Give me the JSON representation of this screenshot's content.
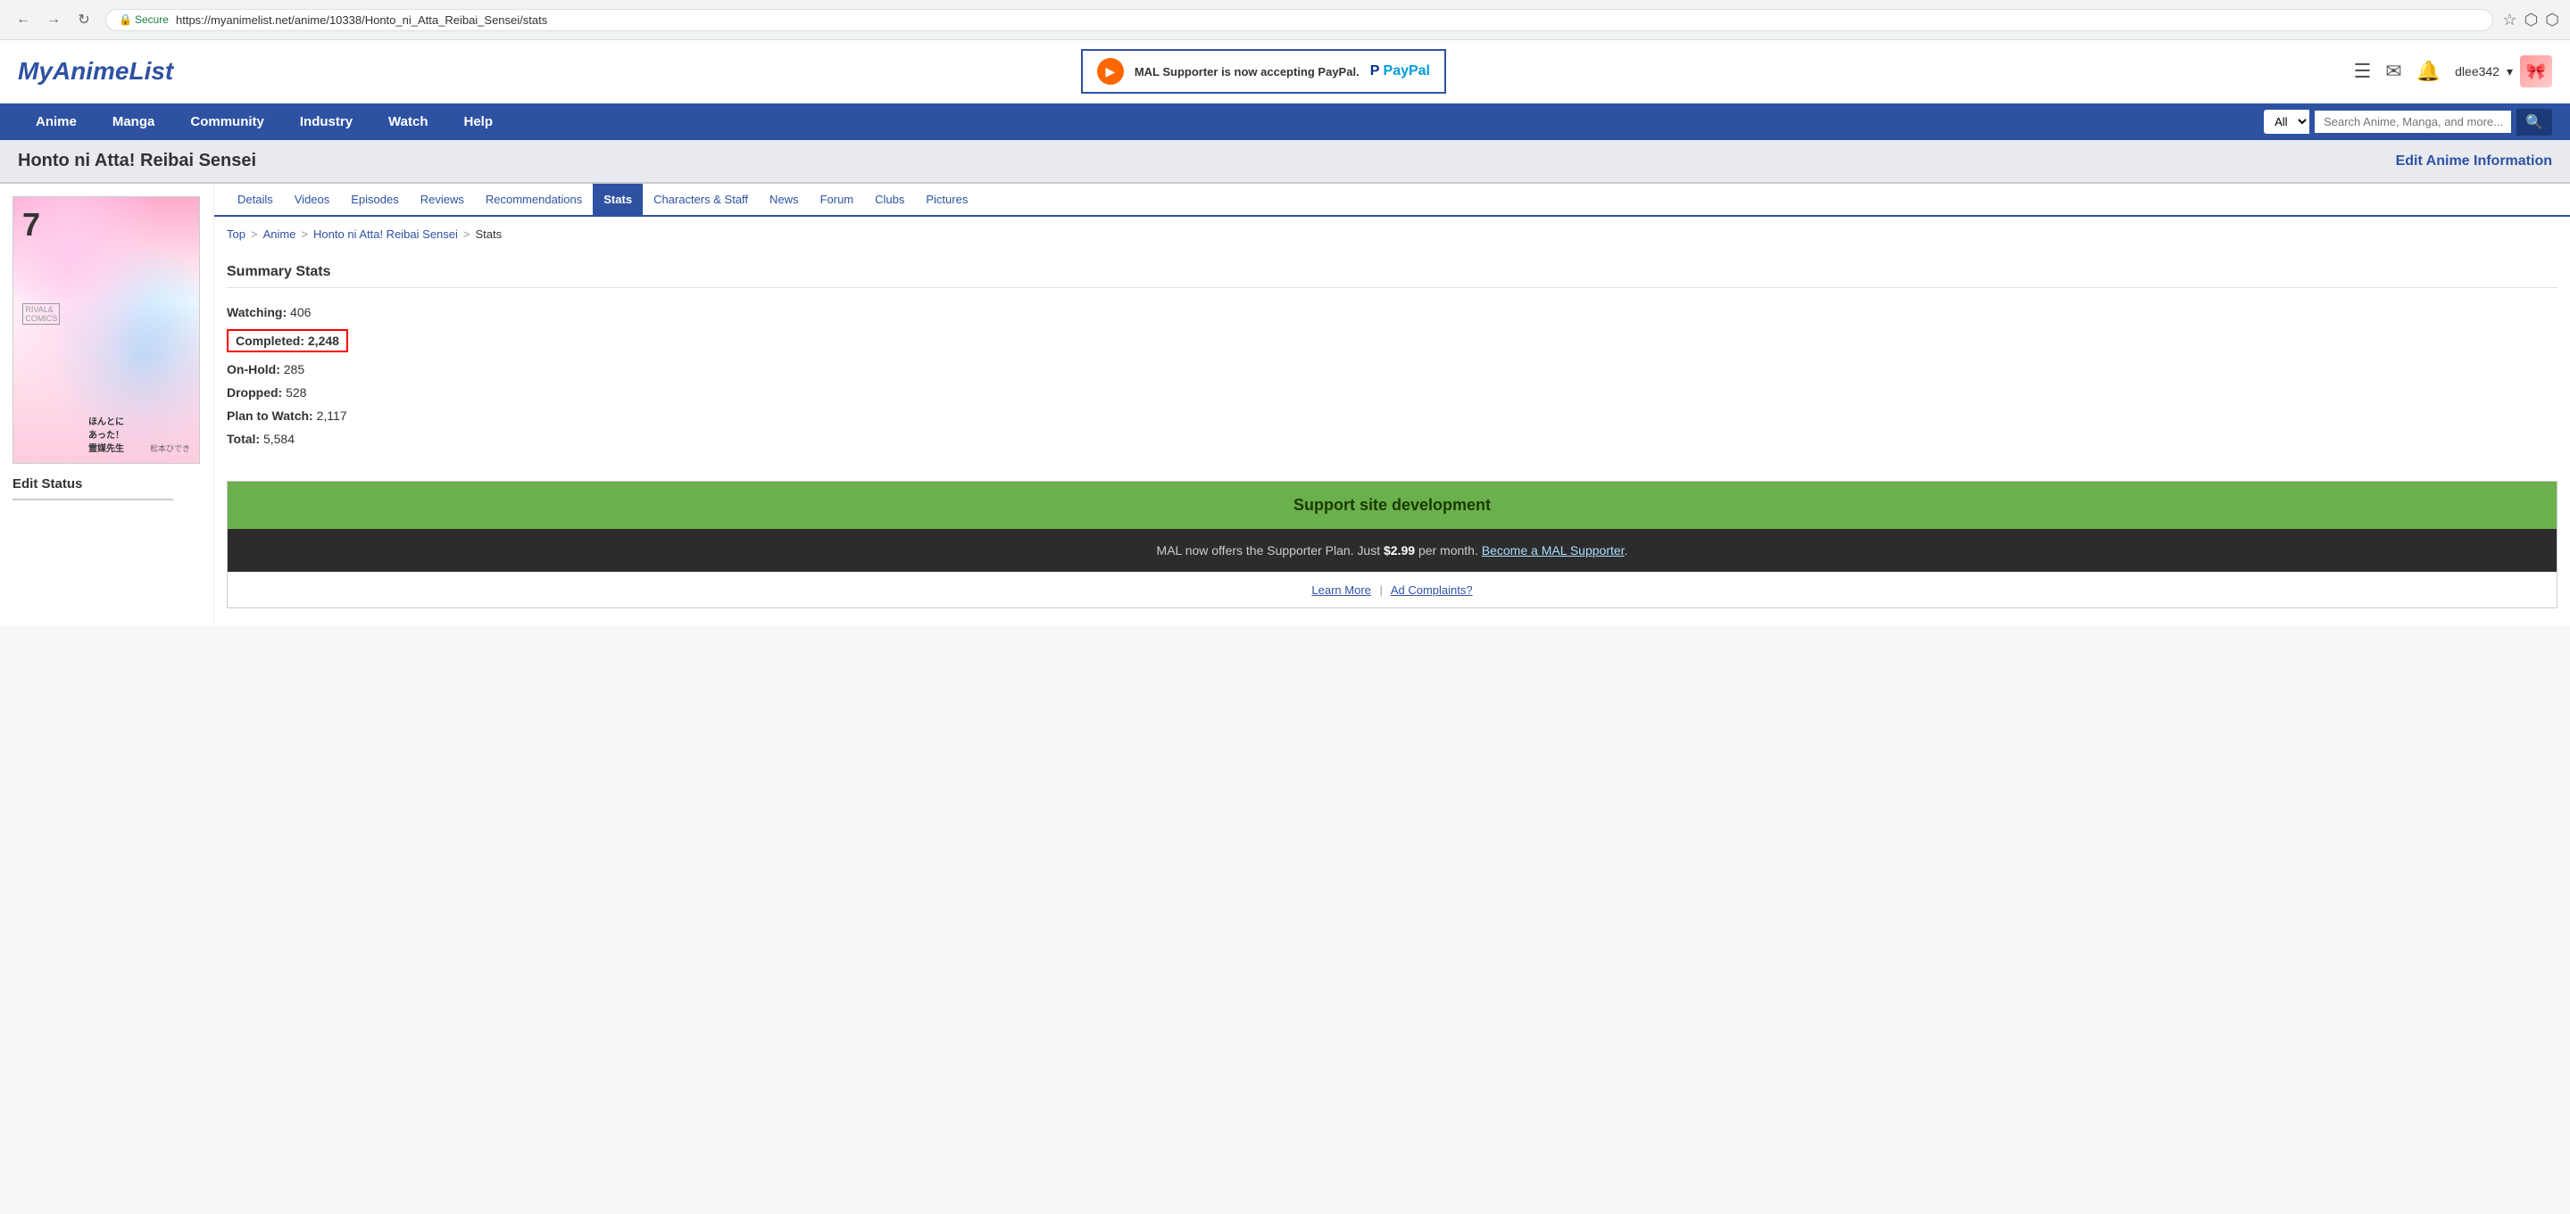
{
  "browser": {
    "url": "https://myanimelist.net/anime/10338/Honto_ni_Atta_Reibai_Sensei/stats",
    "secure_text": "Secure"
  },
  "header": {
    "logo": "MyAnimeList",
    "banner": {
      "text": "MAL Supporter is now accepting PayPal.",
      "paypal": "PayPal"
    },
    "user": "dlee342"
  },
  "nav": {
    "items": [
      "Anime",
      "Manga",
      "Community",
      "Industry",
      "Watch",
      "Help"
    ],
    "search_placeholder": "Search Anime, Manga, and more...",
    "search_options": [
      "All"
    ]
  },
  "page": {
    "title": "Honto ni Atta! Reibai Sensei",
    "edit_link": "Edit Anime Information"
  },
  "tabs": [
    {
      "label": "Details",
      "active": false
    },
    {
      "label": "Videos",
      "active": false
    },
    {
      "label": "Episodes",
      "active": false
    },
    {
      "label": "Reviews",
      "active": false
    },
    {
      "label": "Recommendations",
      "active": false
    },
    {
      "label": "Stats",
      "active": true
    },
    {
      "label": "Characters & Staff",
      "active": false
    },
    {
      "label": "News",
      "active": false
    },
    {
      "label": "Forum",
      "active": false
    },
    {
      "label": "Clubs",
      "active": false
    },
    {
      "label": "Pictures",
      "active": false
    }
  ],
  "breadcrumb": {
    "items": [
      "Top",
      "Anime",
      "Honto ni Atta! Reibai Sensei",
      "Stats"
    ]
  },
  "stats": {
    "title": "Summary Stats",
    "rows": [
      {
        "label": "Watching:",
        "value": "406",
        "highlighted": false
      },
      {
        "label": "Completed:",
        "value": "2,248",
        "highlighted": true
      },
      {
        "label": "On-Hold:",
        "value": "285",
        "highlighted": false
      },
      {
        "label": "Dropped:",
        "value": "528",
        "highlighted": false
      },
      {
        "label": "Plan to Watch:",
        "value": "2,117",
        "highlighted": false
      },
      {
        "label": "Total:",
        "value": "5,584",
        "highlighted": false
      }
    ]
  },
  "sidebar": {
    "edit_status": "Edit Status"
  },
  "support": {
    "title": "Support site development",
    "description": "MAL now offers the Supporter Plan. Just",
    "price": "$2.99",
    "per_month": "per month.",
    "become_link": "Become a MAL Supporter",
    "period": ".",
    "learn_more": "Learn More",
    "ad_complaints": "Ad Complaints?"
  }
}
